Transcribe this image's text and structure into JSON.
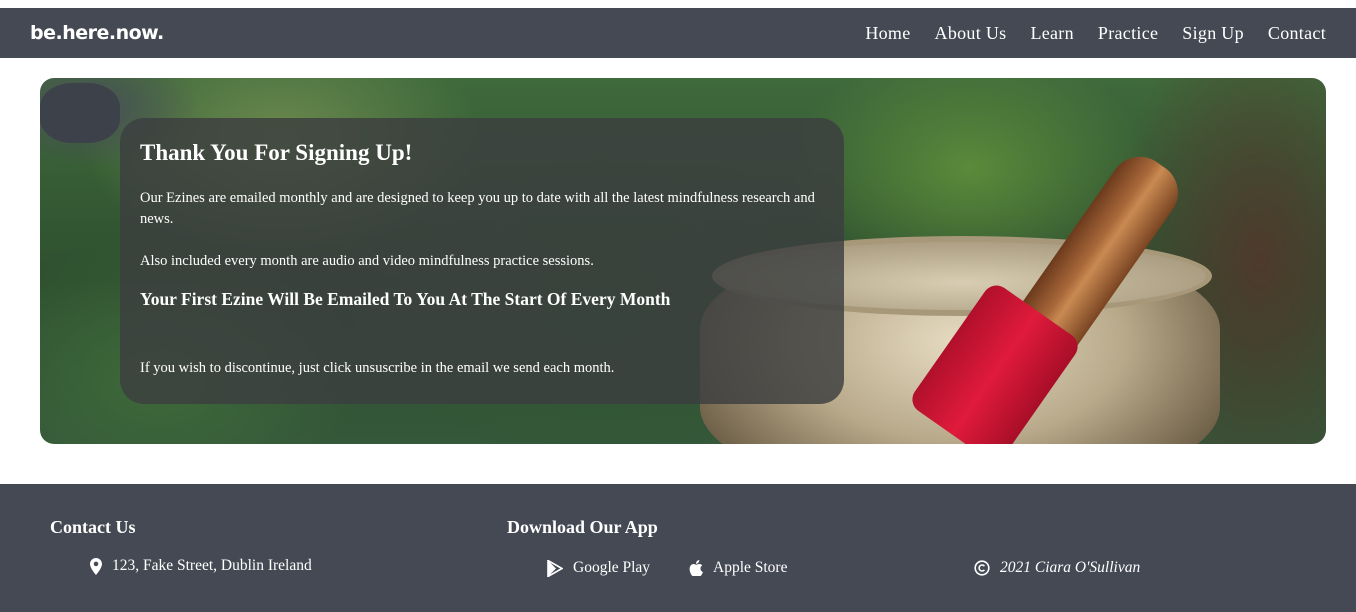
{
  "navbar": {
    "brand": "be.here.now.",
    "links": [
      "Home",
      "About Us",
      "Learn",
      "Practice",
      "Sign Up",
      "Contact"
    ]
  },
  "hero": {
    "image_icon": "singing-bowl-photo",
    "card": {
      "title": "Thank You For Signing Up!",
      "para1": "Our Ezines are emailed monthly and are designed to keep you up to date with all the latest mindfulness research and news.",
      "para2": "Also included every month are audio and video mindfulness practice sessions.",
      "subtitle": "Your First Ezine Will Be Emailed To You At The Start Of Every Month",
      "para3": "If you wish to discontinue, just click unsuscribe in the email we send each month."
    }
  },
  "footer": {
    "contact_heading": "Contact Us",
    "address": "123, Fake Street, Dublin Ireland",
    "address_icon": "map-marker-icon",
    "app_heading": "Download Our App",
    "google_play": "Google Play",
    "google_play_icon": "google-play-icon",
    "apple_store": "Apple Store",
    "apple_store_icon": "apple-icon",
    "copyright": "2021 Ciara O'Sullivan",
    "copyright_icon": "copyright-icon"
  },
  "colors": {
    "nav_bg": "#444954",
    "footer_bg": "#444954",
    "card_bg": "rgba(60,62,64,0.82)",
    "text": "#ffffff"
  }
}
